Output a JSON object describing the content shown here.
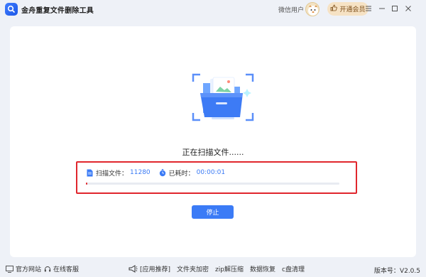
{
  "app": {
    "title": "金舟重复文件删除工具"
  },
  "header": {
    "user_name": "微信用户",
    "vip_button": "开通会员"
  },
  "scan": {
    "status_text": "正在扫描文件......",
    "files_label": "扫描文件：",
    "files_count": "11280",
    "time_label": "已耗时：",
    "elapsed": "00:00:01",
    "progress_fraction": 0.003,
    "stop_button": "停止"
  },
  "footer": {
    "official_site": "官方网站",
    "online_support": "在线客服",
    "recommend": "[应用推荐]",
    "links": [
      "文件夹加密",
      "zip解压缩",
      "数据恢复",
      "c盘清理"
    ],
    "version_label": "版本号：",
    "version": "V2.0.5"
  },
  "colors": {
    "accent": "#3b7bf6",
    "highlight": "#e0262d",
    "vip_bg": "#f6e2c4",
    "background": "#eef1f7"
  }
}
